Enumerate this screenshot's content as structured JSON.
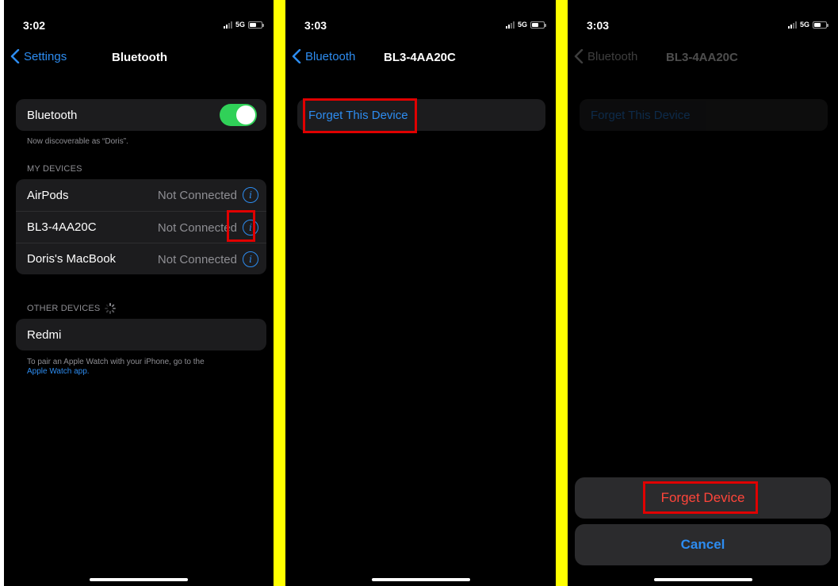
{
  "panel1": {
    "time": "3:02",
    "network": "5G",
    "back_label": "Settings",
    "title": "Bluetooth",
    "bluetooth_label": "Bluetooth",
    "bluetooth_on": true,
    "discoverable_text": "Now discoverable as “Doris”.",
    "my_devices_header": "MY DEVICES",
    "my_devices": [
      {
        "name": "AirPods",
        "status": "Not Connected"
      },
      {
        "name": "BL3-4AA20C",
        "status": "Not Connected"
      },
      {
        "name": "Doris's MacBook",
        "status": "Not Connected"
      }
    ],
    "other_devices_header": "OTHER DEVICES",
    "other_devices": [
      {
        "name": "Redmi"
      }
    ],
    "watch_note": "To pair an Apple Watch with your iPhone, go to the",
    "watch_link": "Apple Watch app."
  },
  "panel2": {
    "time": "3:03",
    "network": "5G",
    "back_label": "Bluetooth",
    "title": "BL3-4AA20C",
    "forget_label": "Forget This Device"
  },
  "panel3": {
    "time": "3:03",
    "network": "5G",
    "back_label": "Bluetooth",
    "title": "BL3-4AA20C",
    "forget_label": "Forget This Device",
    "sheet_forget_label": "Forget Device",
    "sheet_cancel_label": "Cancel"
  },
  "colors": {
    "accent_blue": "#2d8cf0",
    "destructive_red": "#ff453a",
    "toggle_green": "#30d158",
    "highlight_red": "#e00000",
    "separator_yellow": "#ffff00"
  },
  "icons": [
    "chevron-left-icon",
    "info-icon",
    "signal-icon",
    "battery-icon",
    "spinner-icon"
  ]
}
